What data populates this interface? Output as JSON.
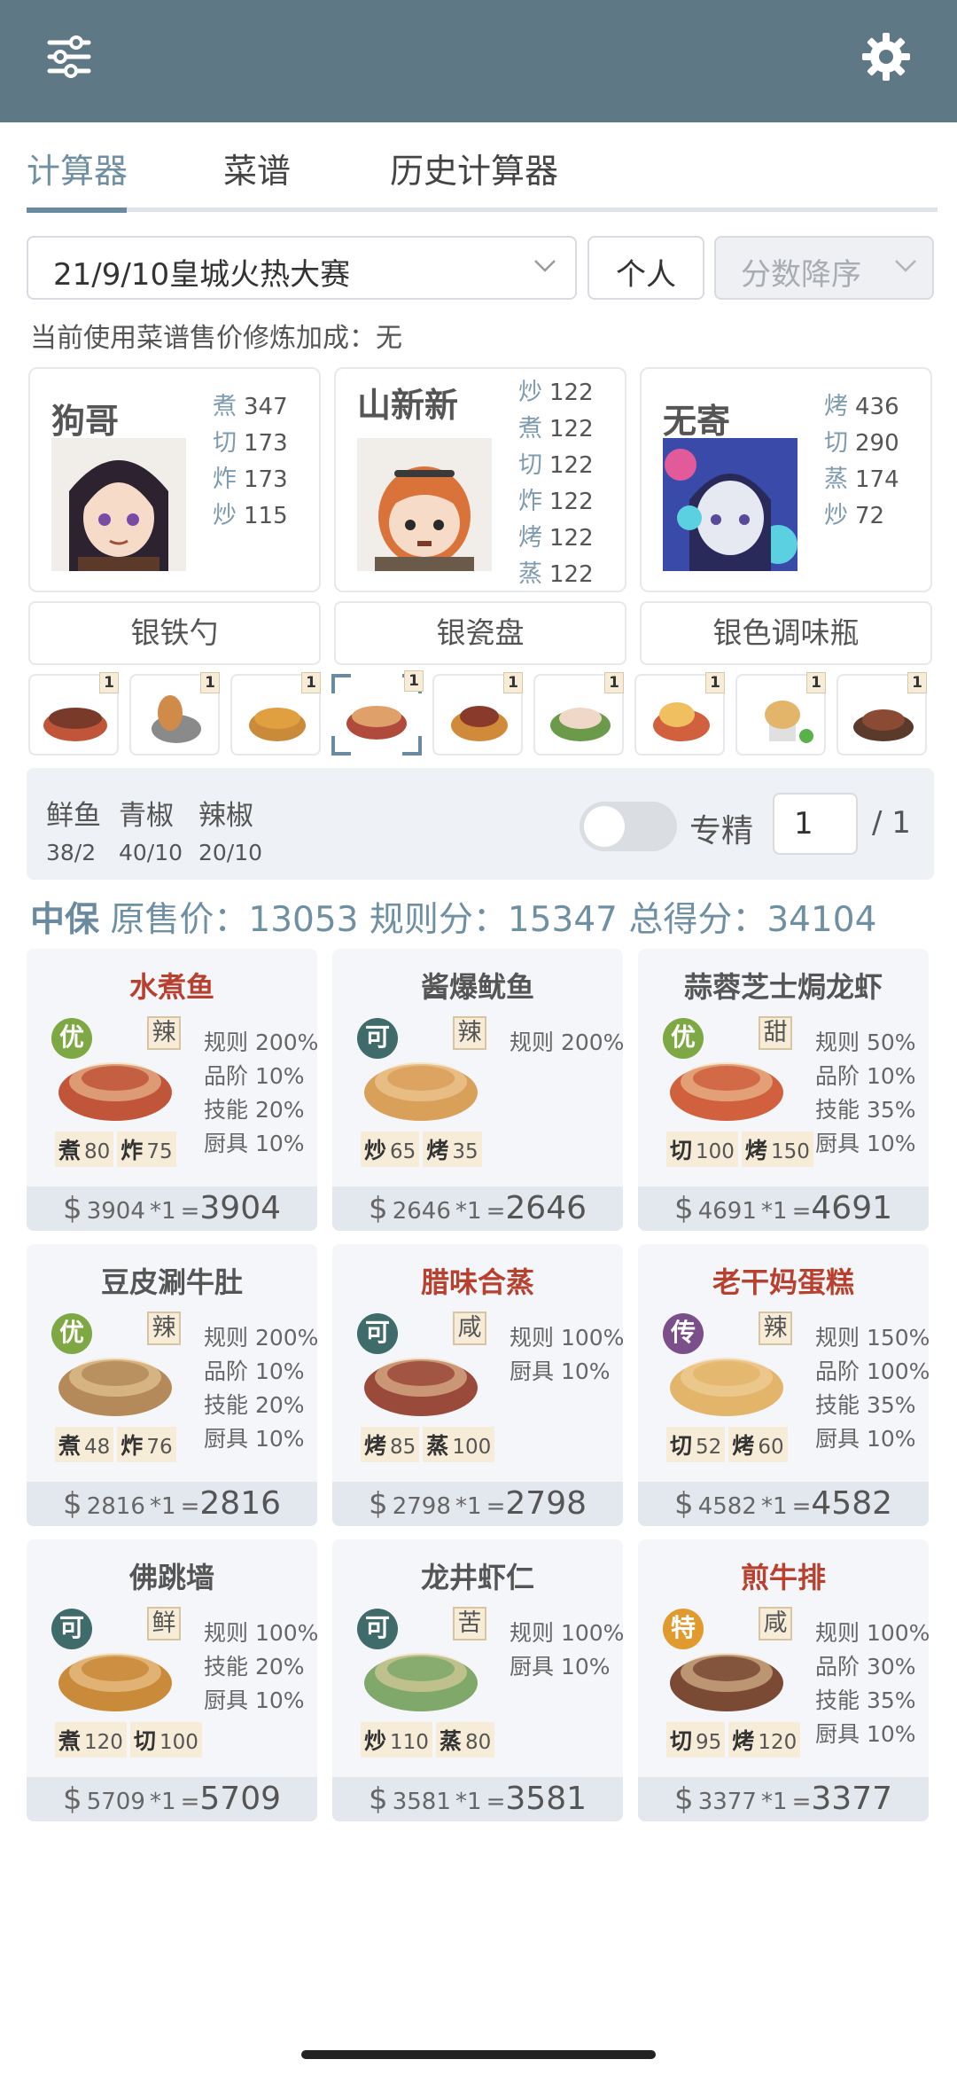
{
  "tabs": [
    "计算器",
    "菜谱",
    "历史计算器"
  ],
  "selectors": {
    "event": "21/9/10皇城火热大赛",
    "mode": "个人",
    "sort": "分数降序"
  },
  "info_line": "当前使用菜谱售价修炼加成：无",
  "chefs": [
    {
      "name": "狗哥",
      "skills": [
        [
          "煮",
          "347"
        ],
        [
          "切",
          "173"
        ],
        [
          "炸",
          "173"
        ],
        [
          "炒",
          "115"
        ]
      ]
    },
    {
      "name": "山新新",
      "skills": [
        [
          "炒",
          "122"
        ],
        [
          "煮",
          "122"
        ],
        [
          "切",
          "122"
        ],
        [
          "炸",
          "122"
        ],
        [
          "烤",
          "122"
        ],
        [
          "蒸",
          "122"
        ]
      ]
    },
    {
      "name": "无寄",
      "skills": [
        [
          "烤",
          "436"
        ],
        [
          "切",
          "290"
        ],
        [
          "蒸",
          "174"
        ],
        [
          "炒",
          "72"
        ]
      ]
    }
  ],
  "equipment": [
    "银铁勺",
    "银瓷盘",
    "银色调味瓶"
  ],
  "dish_strip": [
    {
      "count": "1"
    },
    {
      "count": "1"
    },
    {
      "count": "1"
    },
    {
      "count": "1"
    },
    {
      "count": "1"
    },
    {
      "count": "1"
    },
    {
      "count": "1"
    },
    {
      "count": "1"
    },
    {
      "count": "1"
    }
  ],
  "ingredients": [
    {
      "name": "鲜鱼",
      "qty": "38/2"
    },
    {
      "name": "青椒",
      "qty": "40/10"
    },
    {
      "name": "辣椒",
      "qty": "20/10"
    }
  ],
  "specialize_label": "专精",
  "quantity_value": "1",
  "quantity_total": "/ 1",
  "score": {
    "grade": "中保",
    "text": "原售价：13053 规则分：15347 总得分：34104"
  },
  "dishes": [
    {
      "name": "水煮鱼",
      "red": true,
      "rarity": "优",
      "flavor": "辣",
      "reqs": [
        [
          "煮",
          "80"
        ],
        [
          "炸",
          "75"
        ]
      ],
      "mods": [
        "规则 200%",
        "品阶 10%",
        "技能 20%",
        "厨具 10%"
      ],
      "price": "3904",
      "mult": "*1",
      "total": "3904",
      "color": "#c1553a"
    },
    {
      "name": "酱爆鱿鱼",
      "red": false,
      "rarity": "可",
      "flavor": "辣",
      "reqs": [
        [
          "炒",
          "65"
        ],
        [
          "烤",
          "35"
        ]
      ],
      "mods": [
        "规则 200%"
      ],
      "price": "2646",
      "mult": "*1",
      "total": "2646",
      "color": "#d9a05a"
    },
    {
      "name": "蒜蓉芝士焗龙虾",
      "red": false,
      "rarity": "优",
      "flavor": "甜",
      "reqs": [
        [
          "切",
          "100"
        ],
        [
          "烤",
          "150"
        ]
      ],
      "mods": [
        "规则 50%",
        "品阶 10%",
        "技能 35%",
        "厨具 10%"
      ],
      "price": "4691",
      "mult": "*1",
      "total": "4691",
      "color": "#d0603e"
    },
    {
      "name": "豆皮涮牛肚",
      "red": false,
      "rarity": "优",
      "flavor": "辣",
      "reqs": [
        [
          "煮",
          "48"
        ],
        [
          "炸",
          "76"
        ]
      ],
      "mods": [
        "规则 200%",
        "品阶 10%",
        "技能 20%",
        "厨具 10%"
      ],
      "price": "2816",
      "mult": "*1",
      "total": "2816",
      "color": "#b48a5a"
    },
    {
      "name": "腊味合蒸",
      "red": true,
      "rarity": "可",
      "flavor": "咸",
      "reqs": [
        [
          "烤",
          "85"
        ],
        [
          "蒸",
          "100"
        ]
      ],
      "mods": [
        "规则 100%",
        "厨具 10%"
      ],
      "price": "2798",
      "mult": "*1",
      "total": "2798",
      "color": "#9a4a3a"
    },
    {
      "name": "老干妈蛋糕",
      "red": true,
      "rarity": "传",
      "flavor": "辣",
      "reqs": [
        [
          "切",
          "52"
        ],
        [
          "烤",
          "60"
        ]
      ],
      "mods": [
        "规则 150%",
        "品阶 100%",
        "技能 35%",
        "厨具 10%"
      ],
      "price": "4582",
      "mult": "*1",
      "total": "4582",
      "color": "#e3b56a"
    },
    {
      "name": "佛跳墙",
      "red": false,
      "rarity": "可",
      "flavor": "鲜",
      "reqs": [
        [
          "煮",
          "120"
        ],
        [
          "切",
          "100"
        ]
      ],
      "mods": [
        "规则 100%",
        "技能 20%",
        "厨具 10%"
      ],
      "price": "5709",
      "mult": "*1",
      "total": "5709",
      "color": "#c98a3a"
    },
    {
      "name": "龙井虾仁",
      "red": false,
      "rarity": "可",
      "flavor": "苦",
      "reqs": [
        [
          "炒",
          "110"
        ],
        [
          "蒸",
          "80"
        ]
      ],
      "mods": [
        "规则 100%",
        "厨具 10%"
      ],
      "price": "3581",
      "mult": "*1",
      "total": "3581",
      "color": "#7fa86a"
    },
    {
      "name": "煎牛排",
      "red": true,
      "rarity": "特",
      "flavor": "咸",
      "reqs": [
        [
          "切",
          "95"
        ],
        [
          "烤",
          "120"
        ]
      ],
      "mods": [
        "规则 100%",
        "品阶 30%",
        "技能 35%",
        "厨具 10%"
      ],
      "price": "3377",
      "mult": "*1",
      "total": "3377",
      "color": "#7a4a34"
    }
  ],
  "colors": {
    "header": "#5f7886",
    "accent": "#6a8aa0",
    "red_title": "#b8402e"
  }
}
